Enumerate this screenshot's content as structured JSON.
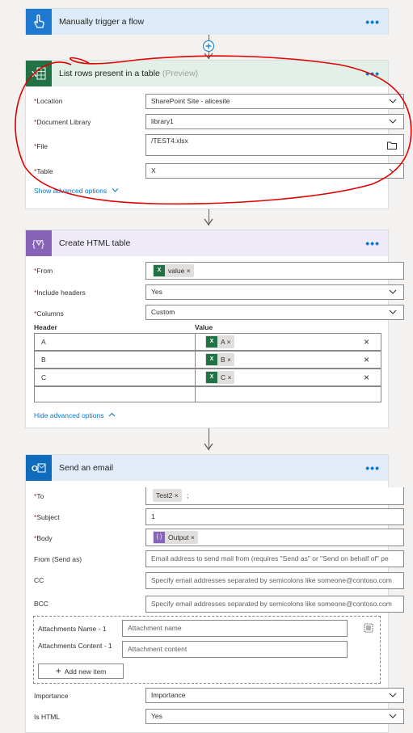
{
  "trigger": {
    "title": "Manually trigger a flow",
    "more": "•••"
  },
  "list_rows": {
    "title": "List rows present in a table",
    "preview": "(Preview)",
    "more": "•••",
    "location_label": "Location",
    "location_value": "SharePoint Site - alicesite",
    "library_label": "Document Library",
    "library_value": "library1",
    "file_label": "File",
    "file_value": "/TEST4.xlsx",
    "table_label": "Table",
    "table_value": "X",
    "advanced_link": "Show advanced options"
  },
  "html_table": {
    "title": "Create HTML table",
    "more": "•••",
    "from_label": "From",
    "from_token": "value",
    "include_headers_label": "Include headers",
    "include_headers_value": "Yes",
    "columns_label": "Columns",
    "columns_value": "Custom",
    "header_col": "Header",
    "value_col": "Value",
    "rows": [
      {
        "header": "A",
        "value": "A"
      },
      {
        "header": "B",
        "value": "B"
      },
      {
        "header": "C",
        "value": "C"
      }
    ],
    "advanced_link": "Hide advanced options"
  },
  "email": {
    "title": "Send an email",
    "more": "•••",
    "to_label": "To",
    "to_token": "Test2",
    "to_sep": ";",
    "subject_label": "Subject",
    "subject_value": "1",
    "body_label": "Body",
    "body_token": "Output",
    "from_label": "From (Send as)",
    "from_placeholder": "Email address to send mail from (requires \"Send as\" or \"Send on behalf of\" pe",
    "cc_label": "CC",
    "cc_placeholder": "Specify email addresses separated by semicolons like someone@contoso.com",
    "bcc_label": "BCC",
    "bcc_placeholder": "Specify email addresses separated by semicolons like someone@contoso.com",
    "att_name_label": "Attachments Name - 1",
    "att_name_placeholder": "Attachment name",
    "att_content_label": "Attachments Content - 1",
    "att_content_placeholder": "Attachment content",
    "add_item": "Add new item",
    "importance_label": "Importance",
    "importance_value": "Importance",
    "is_html_label": "Is HTML",
    "is_html_value": "Yes"
  },
  "colors": {
    "excel": "#217346",
    "trigger": "#1e7ad1",
    "data_op": "#8764b8",
    "outlook": "#0f6cbd",
    "annotation": "#e00000"
  }
}
